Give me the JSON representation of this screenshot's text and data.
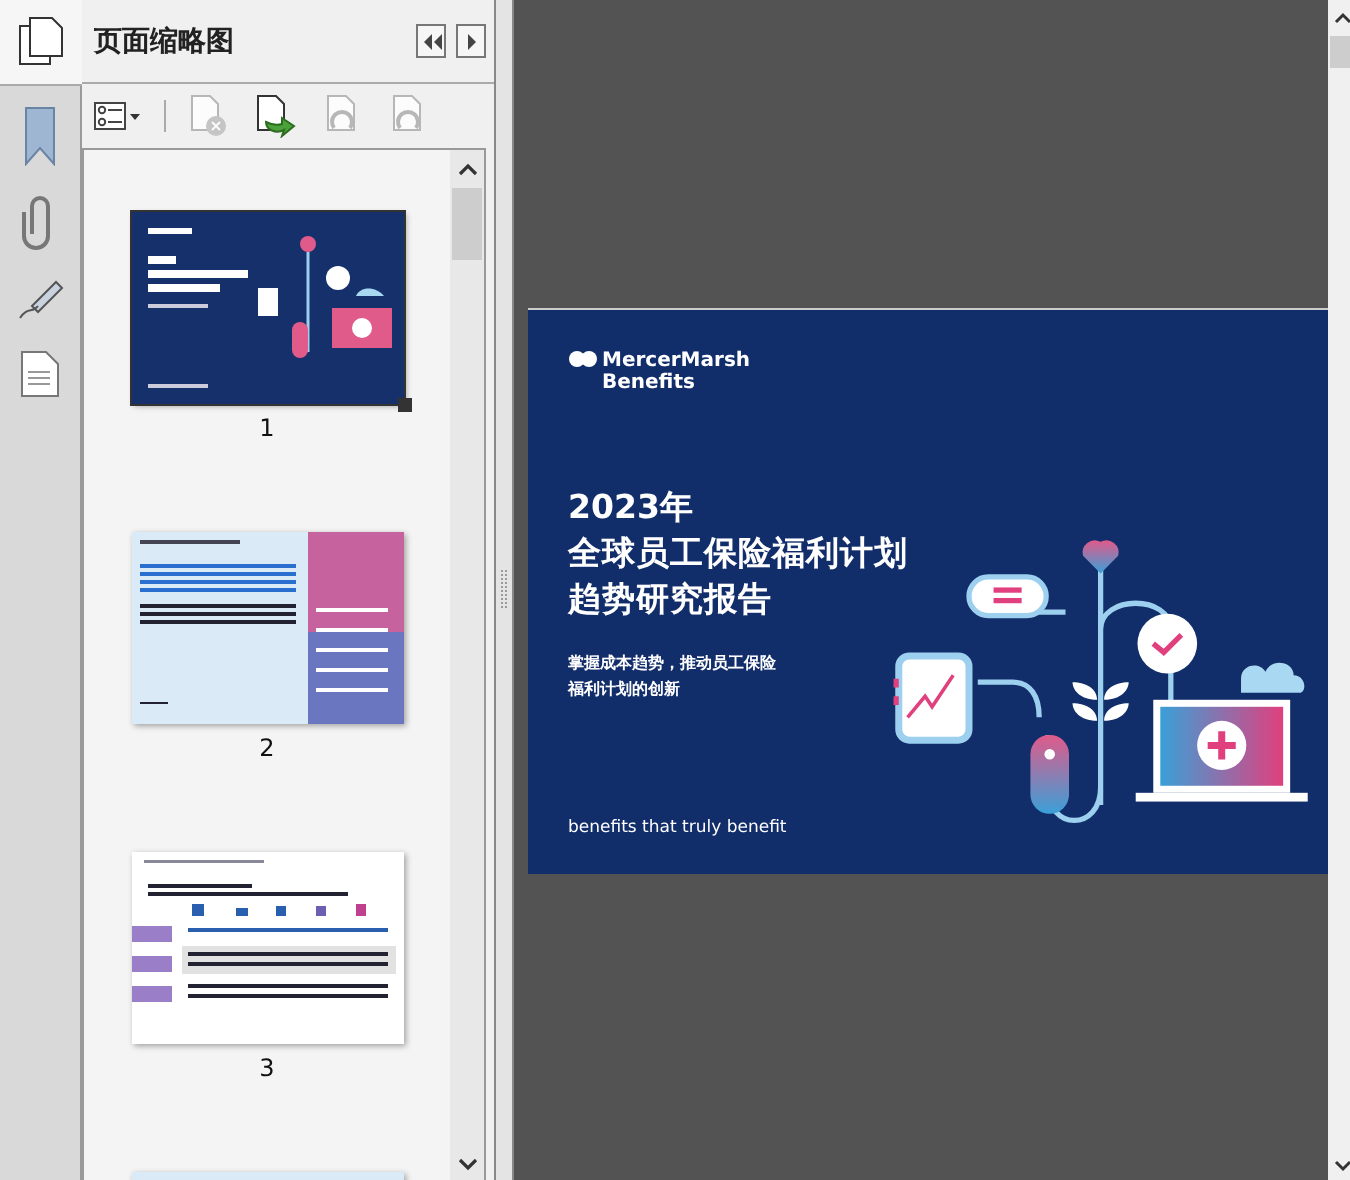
{
  "panel": {
    "title": "页面缩略图"
  },
  "thumbnails": [
    {
      "kind": "cover",
      "label": "1",
      "selected": true
    },
    {
      "kind": "split",
      "label": "2",
      "selected": false
    },
    {
      "kind": "table",
      "label": "3",
      "selected": false
    },
    {
      "kind": "note",
      "selected": false
    }
  ],
  "page": {
    "logo_lines": [
      "MercerMarsh",
      "Benefits"
    ],
    "title_lines": [
      "2023年",
      "全球员工保险福利计划",
      "趋势研究报告"
    ],
    "subtitle_lines": [
      "掌握成本趋势，推动员工保险",
      "福利计划的创新"
    ],
    "tagline": "benefits that truly benefit"
  }
}
